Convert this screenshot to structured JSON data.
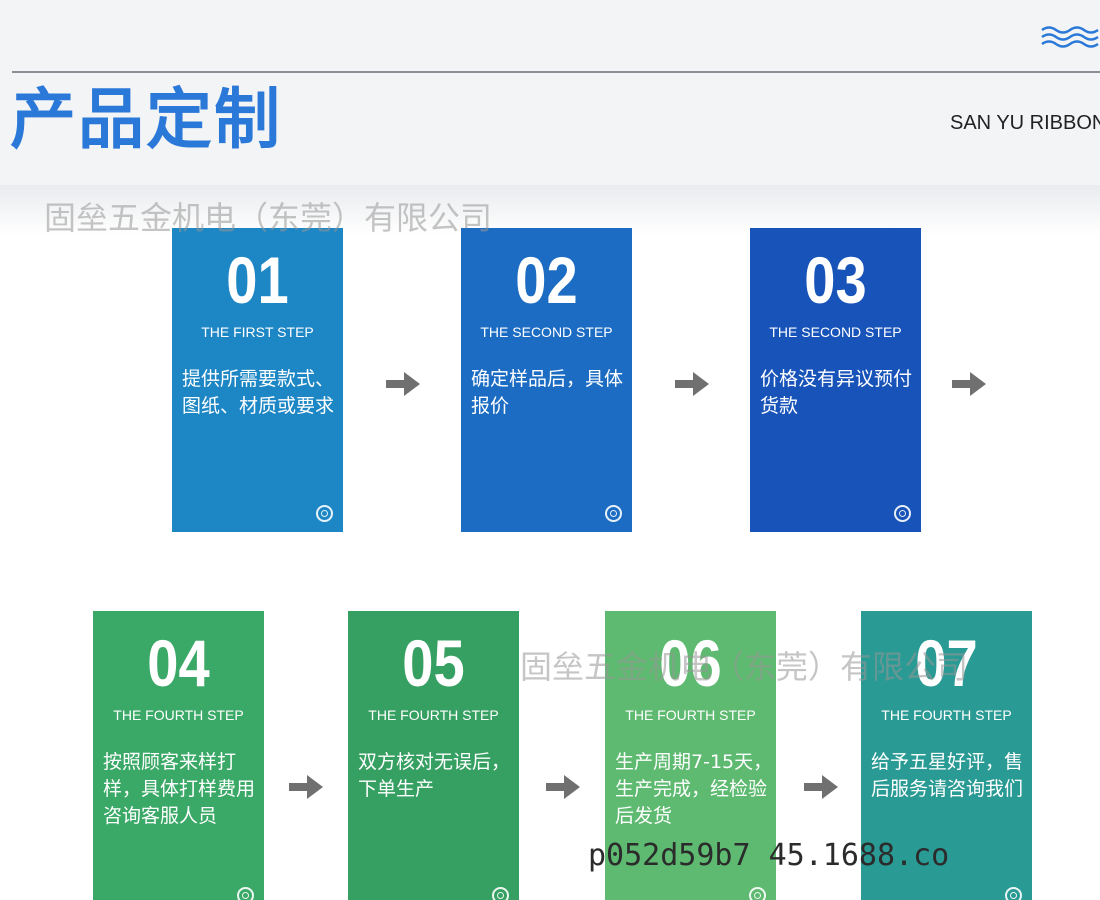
{
  "header": {
    "title": "产品定制",
    "brand": "SAN YU RIBBON"
  },
  "watermarks": {
    "top": "固垒五金机电（东莞）有限公司",
    "middle": "固垒五金机电（东莞）有限公司",
    "url": "p052d59b7     45.1688.co"
  },
  "steps": [
    {
      "number": "01",
      "label": "THE FIRST STEP",
      "text": "提供所需要款式、图纸、材质或要求",
      "color": "#1d86c4"
    },
    {
      "number": "02",
      "label": "THE SECOND STEP",
      "text": "确定样品后，具体报价",
      "color": "#1b6cc2"
    },
    {
      "number": "03",
      "label": "THE SECOND STEP",
      "text": "价格没有异议预付货款",
      "color": "#1753b8"
    },
    {
      "number": "04",
      "label": "THE FOURTH STEP",
      "text": "按照顾客来样打样，具体打样费用咨询客服人员",
      "color": "#3aa866"
    },
    {
      "number": "05",
      "label": "THE FOURTH STEP",
      "text": "双方核对无误后，下单生产",
      "color": "#36a062"
    },
    {
      "number": "06",
      "label": "THE FOURTH STEP",
      "text": "生产周期7-15天，生产完成，经检验后发货",
      "color": "#5dba70"
    },
    {
      "number": "07",
      "label": "THE FOURTH STEP",
      "text": "给予五星好评，售后服务请咨询我们",
      "color": "#2a9a94"
    }
  ],
  "icons": {
    "arrow": "arrow-right-icon",
    "ring": "target-ring-icon",
    "waves": "wave-lines-icon"
  }
}
